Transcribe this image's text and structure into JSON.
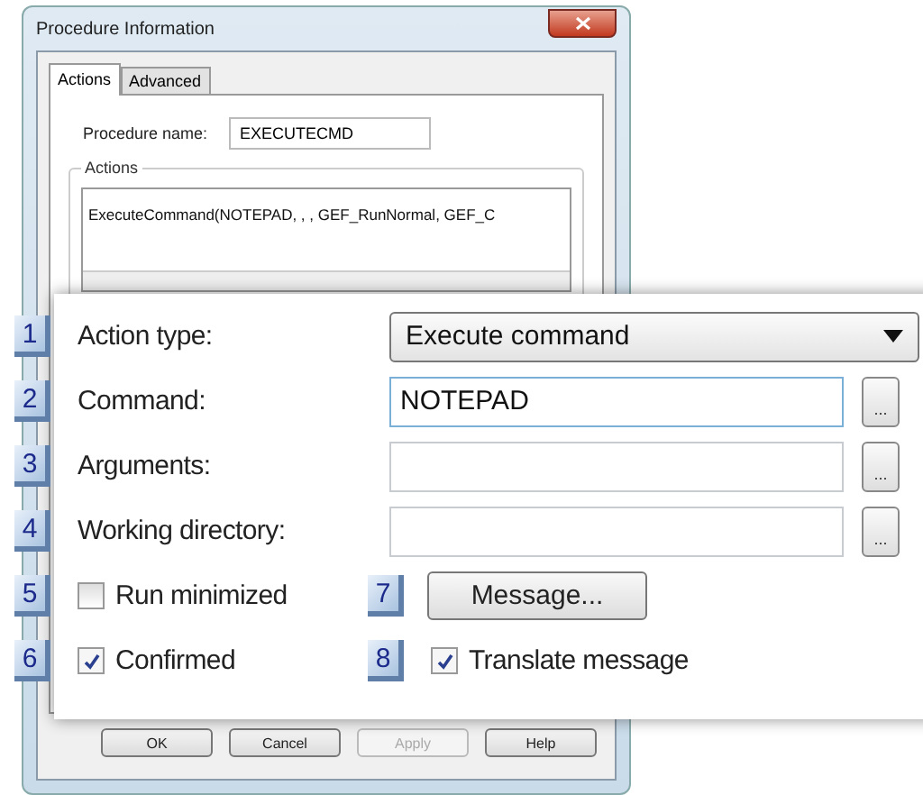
{
  "window": {
    "title": "Procedure Information"
  },
  "tabs": [
    {
      "label": "Actions",
      "selected": true
    },
    {
      "label": "Advanced",
      "selected": false
    }
  ],
  "procedure_name": {
    "label": "Procedure name:",
    "value": "EXECUTECMD"
  },
  "actions_group": {
    "title": "Actions",
    "items": [
      "ExecuteCommand(NOTEPAD, , , GEF_RunNormal, GEF_C"
    ]
  },
  "buttons": [
    {
      "label": "OK",
      "disabled": false
    },
    {
      "label": "Cancel",
      "disabled": false
    },
    {
      "label": "Apply",
      "disabled": true
    },
    {
      "label": "Help",
      "disabled": false
    }
  ],
  "detail": {
    "fields": [
      {
        "number": "1",
        "kind": "dropdown",
        "label": "Action type:",
        "value": "Execute command"
      },
      {
        "number": "2",
        "kind": "field",
        "label": "Command:",
        "value": "NOTEPAD",
        "browse": "..."
      },
      {
        "number": "3",
        "kind": "field",
        "label": "Arguments:",
        "browse": "..."
      },
      {
        "number": "4",
        "kind": "field",
        "label": "Working directory:",
        "browse": "..."
      }
    ],
    "option_rows": [
      [
        {
          "number": "5",
          "kind": "checkbox",
          "label": "Run minimized",
          "checked": false
        },
        {
          "number": "7",
          "kind": "button",
          "label": "Message..."
        }
      ],
      [
        {
          "number": "6",
          "kind": "checkbox",
          "label": "Confirmed",
          "checked": true
        },
        {
          "number": "8",
          "kind": "checkbox",
          "label": "Translate message",
          "checked": true
        }
      ]
    ]
  }
}
